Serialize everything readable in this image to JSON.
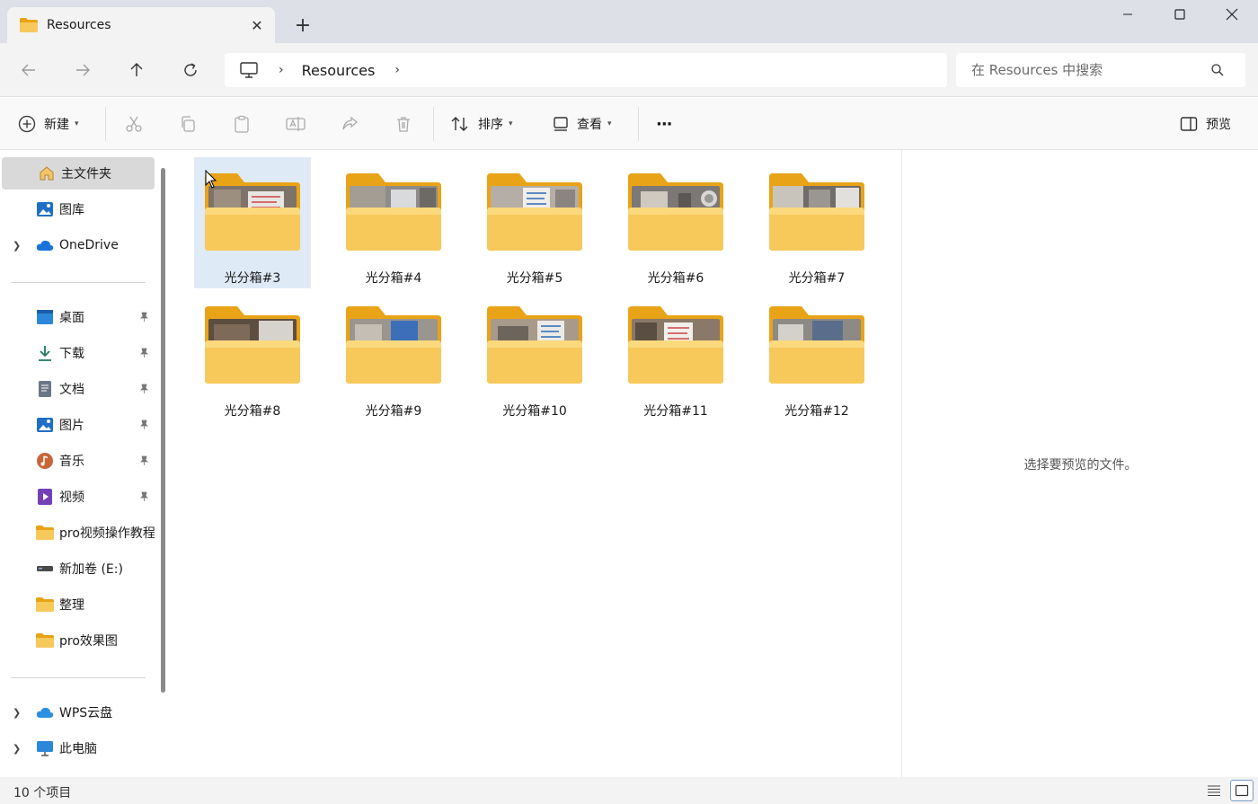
{
  "window": {
    "tab_title": "Resources",
    "tab_close": "✕",
    "new_tab": "+"
  },
  "address": {
    "breadcrumb_sep": "›",
    "breadcrumb": [
      "Resources"
    ],
    "search_placeholder": "在 Resources 中搜索"
  },
  "toolbar": {
    "new_label": "新建",
    "sort_label": "排序",
    "view_label": "查看",
    "more_label": "···",
    "preview_label": "预览"
  },
  "sidebar": {
    "items": [
      {
        "label": "主文件夹",
        "icon": "home-icon",
        "active": true
      },
      {
        "label": "图库",
        "icon": "gallery-icon"
      },
      {
        "label": "OneDrive",
        "icon": "onedrive-icon",
        "expandable": true
      },
      {
        "label": "桌面",
        "icon": "desktop-icon",
        "pinned": true
      },
      {
        "label": "下载",
        "icon": "download-icon",
        "pinned": true
      },
      {
        "label": "文档",
        "icon": "documents-icon",
        "pinned": true
      },
      {
        "label": "图片",
        "icon": "pictures-icon",
        "pinned": true
      },
      {
        "label": "音乐",
        "icon": "music-icon",
        "pinned": true
      },
      {
        "label": "视频",
        "icon": "videos-icon",
        "pinned": true
      },
      {
        "label": "pro视频操作教程",
        "icon": "folder-icon"
      },
      {
        "label": "新加卷 (E:)",
        "icon": "drive-icon"
      },
      {
        "label": "整理",
        "icon": "folder-icon"
      },
      {
        "label": "pro效果图",
        "icon": "folder-icon"
      },
      {
        "label": "WPS云盘",
        "icon": "wps-cloud-icon",
        "expandable": true
      },
      {
        "label": "此电脑",
        "icon": "this-pc-icon",
        "expandable": true
      }
    ]
  },
  "folders": [
    {
      "name": "光分箱#3",
      "selected": true
    },
    {
      "name": "光分箱#4"
    },
    {
      "name": "光分箱#5"
    },
    {
      "name": "光分箱#6"
    },
    {
      "name": "光分箱#7"
    },
    {
      "name": "光分箱#8"
    },
    {
      "name": "光分箱#9"
    },
    {
      "name": "光分箱#10"
    },
    {
      "name": "光分箱#11"
    },
    {
      "name": "光分箱#12"
    }
  ],
  "preview": {
    "message": "选择要预览的文件。"
  },
  "status": {
    "item_count": "10 个项目"
  },
  "colors": {
    "folder_back": "#e8a317",
    "folder_front": "#f7c95b",
    "selection": "#dfeaf7",
    "active_nav": "#d9d9d9"
  }
}
